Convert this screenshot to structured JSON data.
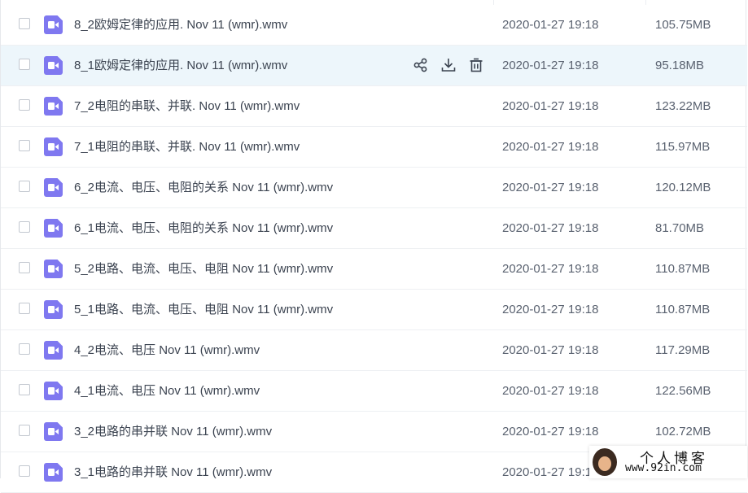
{
  "files": [
    {
      "name": "8_2欧姆定律的应用. Nov 11 (wmr).wmv",
      "date": "2020-01-27 19:18",
      "size": "105.75MB",
      "hovered": false
    },
    {
      "name": "8_1欧姆定律的应用. Nov 11 (wmr).wmv",
      "date": "2020-01-27 19:18",
      "size": "95.18MB",
      "hovered": true
    },
    {
      "name": "7_2电阻的串联、并联. Nov 11 (wmr).wmv",
      "date": "2020-01-27 19:18",
      "size": "123.22MB",
      "hovered": false
    },
    {
      "name": "7_1电阻的串联、并联. Nov 11 (wmr).wmv",
      "date": "2020-01-27 19:18",
      "size": "115.97MB",
      "hovered": false
    },
    {
      "name": "6_2电流、电压、电阻的关系 Nov 11 (wmr).wmv",
      "date": "2020-01-27 19:18",
      "size": "120.12MB",
      "hovered": false
    },
    {
      "name": "6_1电流、电压、电阻的关系 Nov 11 (wmr).wmv",
      "date": "2020-01-27 19:18",
      "size": "81.70MB",
      "hovered": false
    },
    {
      "name": "5_2电路、电流、电压、电阻 Nov 11 (wmr).wmv",
      "date": "2020-01-27 19:18",
      "size": "110.87MB",
      "hovered": false
    },
    {
      "name": "5_1电路、电流、电压、电阻 Nov 11 (wmr).wmv",
      "date": "2020-01-27 19:18",
      "size": "110.87MB",
      "hovered": false
    },
    {
      "name": "4_2电流、电压 Nov 11 (wmr).wmv",
      "date": "2020-01-27 19:18",
      "size": "117.29MB",
      "hovered": false
    },
    {
      "name": "4_1电流、电压 Nov 11 (wmr).wmv",
      "date": "2020-01-27 19:18",
      "size": "122.56MB",
      "hovered": false
    },
    {
      "name": "3_2电路的串并联 Nov 11 (wmr).wmv",
      "date": "2020-01-27 19:18",
      "size": "102.72MB",
      "hovered": false
    },
    {
      "name": "3_1电路的串并联 Nov 11 (wmr).wmv",
      "date": "2020-01-27 19:18",
      "size": "",
      "hovered": false
    }
  ],
  "row_actions": [
    "share-icon",
    "download-icon",
    "delete-icon"
  ],
  "file_icon": "video-file-icon",
  "colors": {
    "accent": "#7f78f0",
    "hover_row": "#edf6fb"
  },
  "watermark": {
    "title": "个人博客",
    "url": "www.92in.com"
  }
}
